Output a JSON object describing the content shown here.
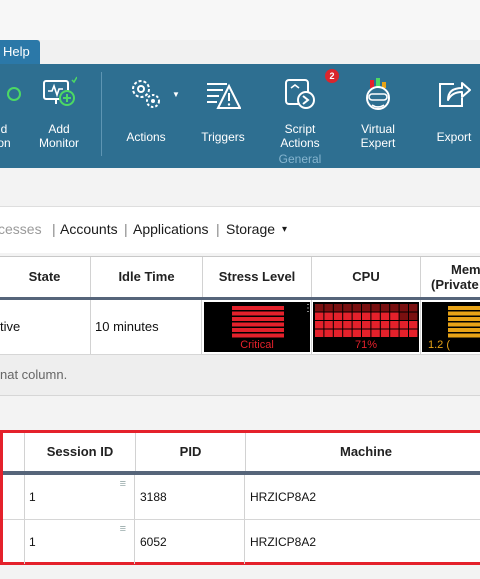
{
  "menu": {
    "help_label": "Help"
  },
  "ribbon": {
    "buttons": [
      {
        "label_line1": "d",
        "label_line2": "on"
      },
      {
        "label_line1": "Add",
        "label_line2": "Monitor"
      },
      {
        "label_line1": "Actions"
      },
      {
        "label_line1": "Triggers"
      },
      {
        "label_line1": "Script",
        "label_line2": "Actions"
      },
      {
        "label_line1": "Virtual",
        "label_line2": "Expert"
      },
      {
        "label_line1": "Export"
      }
    ],
    "script_badge": "2",
    "group_label": "General",
    "colors": {
      "ribbon_bg": "#2e6f91",
      "badge": "#d9262d"
    }
  },
  "tabs": {
    "items": [
      "cesses",
      "Accounts",
      "Applications",
      "Storage"
    ],
    "storage_caret": "▾"
  },
  "processes_table": {
    "headers": [
      "State",
      "Idle Time",
      "Stress Level",
      "CPU",
      "Mem",
      "(Private"
    ],
    "row": {
      "state": "tive",
      "idle_time": "10 minutes",
      "stress_label": "Critical",
      "stress_level": 1.0,
      "cpu_label": "71%",
      "cpu_level": 0.71,
      "mem_label": "1.2 ("
    },
    "colors": {
      "critical": "#e4212b",
      "mem": "#e8a317"
    }
  },
  "hint": {
    "text": "nat column."
  },
  "sessions_table": {
    "headers": [
      "Session ID",
      "PID",
      "Machine"
    ],
    "rows": [
      {
        "session_id": "1",
        "pid": "3188",
        "machine": "HRZICP8A2"
      },
      {
        "session_id": "1",
        "pid": "6052",
        "machine": "HRZICP8A2"
      }
    ],
    "highlight_color": "#e4212b"
  }
}
